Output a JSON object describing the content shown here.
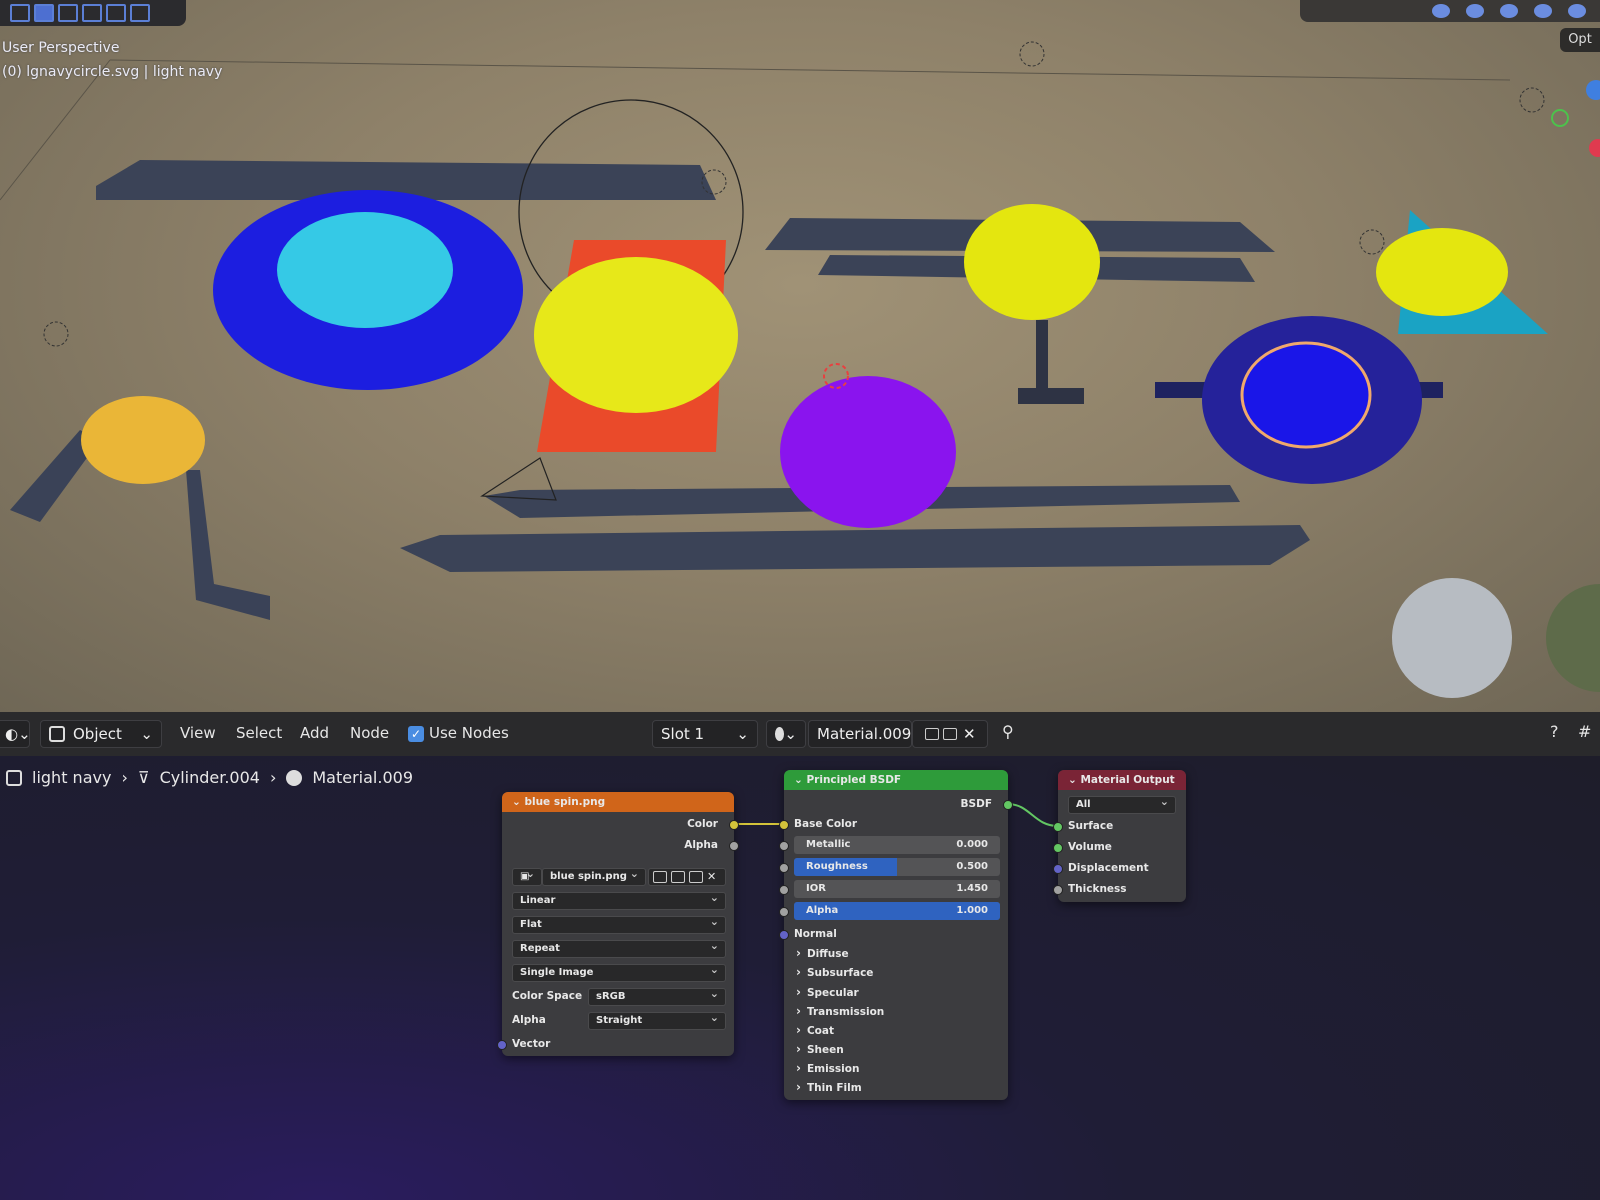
{
  "viewport": {
    "mode_label": "User Perspective",
    "object_info": "(0) lgnavycircle.svg | light navy",
    "options_label": "Opt"
  },
  "header": {
    "editor_mode": "Object",
    "menus": [
      "View",
      "Select",
      "Add",
      "Node"
    ],
    "use_nodes_label": "Use Nodes",
    "use_nodes_checked": true,
    "slot": "Slot 1",
    "material": "Material.009"
  },
  "breadcrumb": {
    "object": "light navy",
    "mesh": "Cylinder.004",
    "material": "Material.009"
  },
  "image_node": {
    "title": "blue spin.png",
    "outputs": [
      "Color",
      "Alpha"
    ],
    "image_name": "blue spin.png",
    "interpolation": "Linear",
    "projection": "Flat",
    "extension": "Repeat",
    "source": "Single Image",
    "color_space_label": "Color Space",
    "color_space": "sRGB",
    "alpha_label": "Alpha",
    "alpha_mode": "Straight",
    "input_vector": "Vector",
    "header_color": "#d0651a"
  },
  "bsdf_node": {
    "title": "Principled BSDF",
    "output": "BSDF",
    "base_color_label": "Base Color",
    "metallic": {
      "label": "Metallic",
      "value": "0.000",
      "fraction": 0.0
    },
    "roughness": {
      "label": "Roughness",
      "value": "0.500",
      "fraction": 0.5
    },
    "ior": {
      "label": "IOR",
      "value": "1.450"
    },
    "alpha": {
      "label": "Alpha",
      "value": "1.000",
      "fraction": 1.0
    },
    "normal_label": "Normal",
    "panels": [
      "Diffuse",
      "Subsurface",
      "Specular",
      "Transmission",
      "Coat",
      "Sheen",
      "Emission",
      "Thin Film"
    ],
    "header_color": "#2e9b3a"
  },
  "output_node": {
    "title": "Material Output",
    "target": "All",
    "inputs": [
      "Surface",
      "Volume",
      "Displacement",
      "Thickness"
    ],
    "header_color": "#7a2436"
  }
}
